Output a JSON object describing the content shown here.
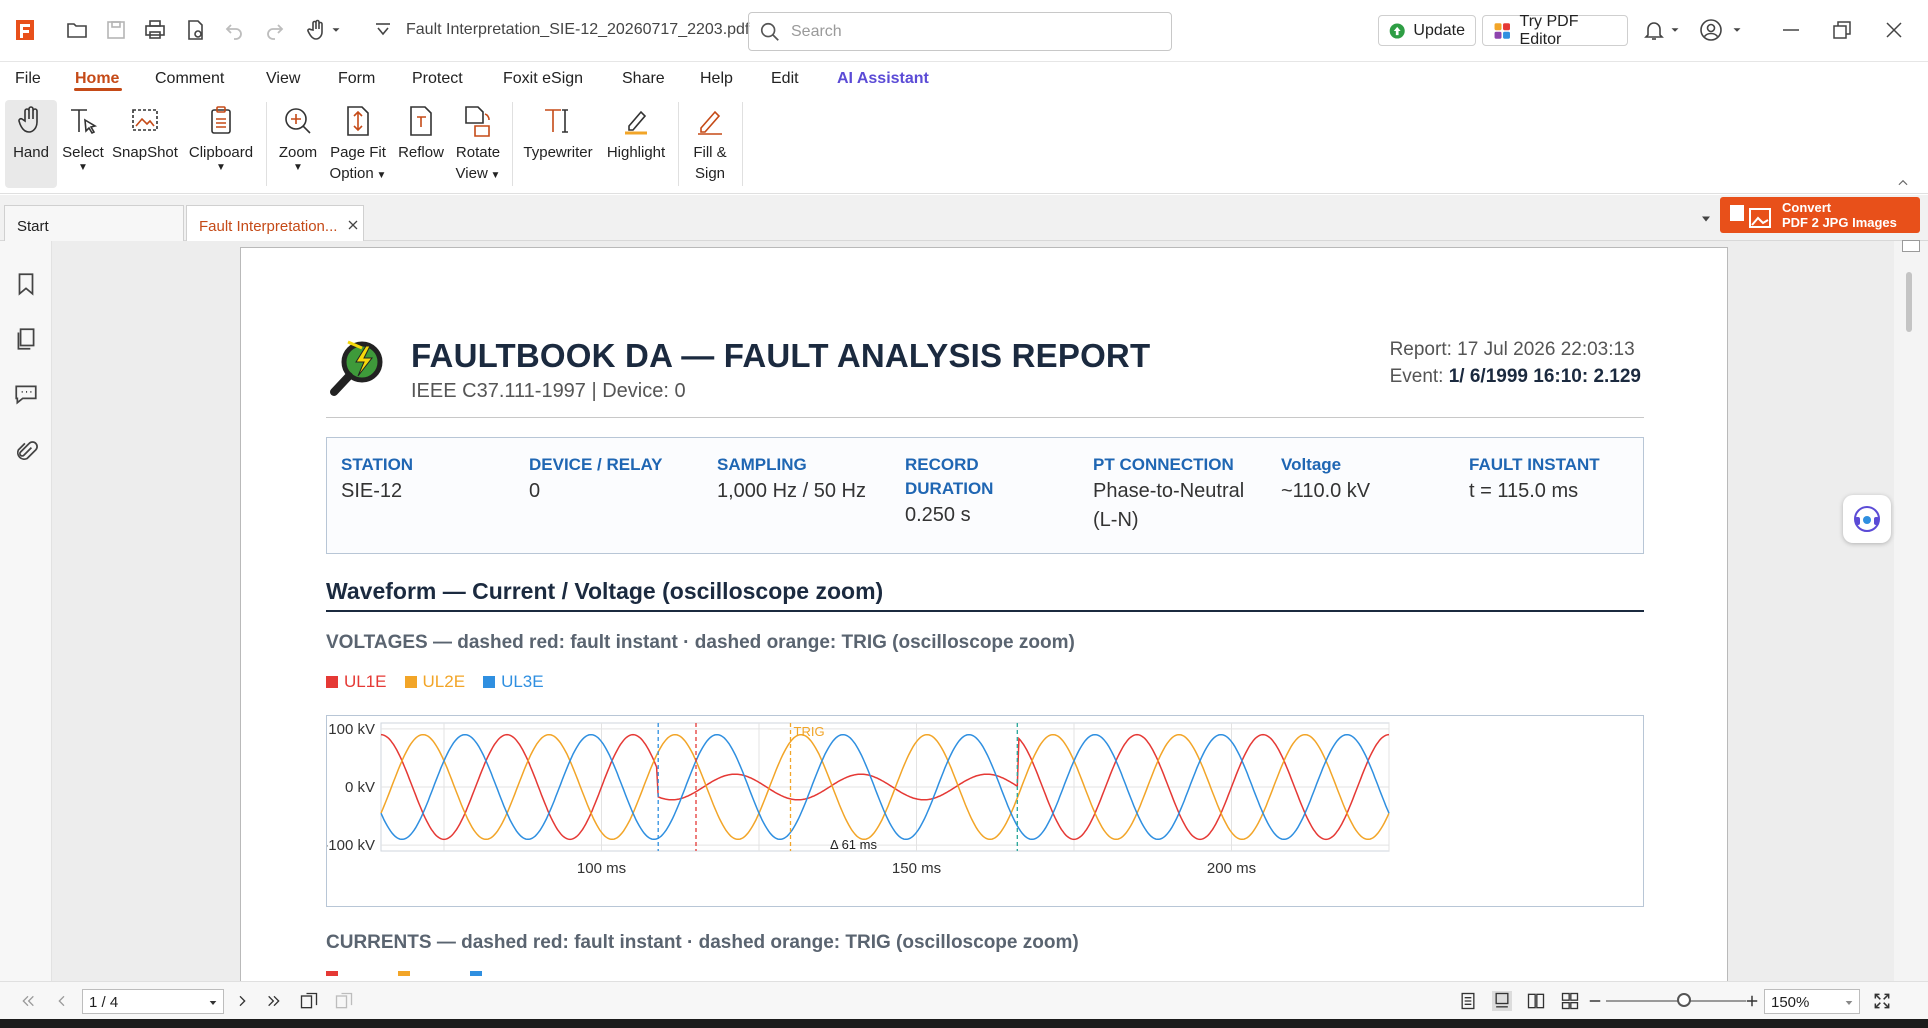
{
  "titlebar": {
    "filename": "Fault Interpretation_SIE-12_20260717_2203.pdf",
    "search_placeholder": "Search",
    "update_label": "Update",
    "try_editor_label": "Try PDF Editor"
  },
  "menu": [
    "File",
    "Home",
    "Comment",
    "View",
    "Form",
    "Protect",
    "Foxit eSign",
    "Share",
    "Help",
    "Edit",
    "AI Assistant"
  ],
  "ribbon": {
    "hand": "Hand",
    "select": "Select",
    "snapshot": "SnapShot",
    "clipboard": "Clipboard",
    "zoom": "Zoom",
    "pagefit_1": "Page Fit",
    "pagefit_2": "Option",
    "reflow": "Reflow",
    "rotate_1": "Rotate",
    "rotate_2": "View",
    "typewriter": "Typewriter",
    "highlight": "Highlight",
    "fill_1": "Fill &",
    "fill_2": "Sign"
  },
  "tabs": {
    "start": "Start",
    "doc": "Fault Interpretation..."
  },
  "convert": {
    "line1": "Convert",
    "line2": "PDF 2 JPG Images"
  },
  "report": {
    "title": "FAULTBOOK DA — FAULT ANALYSIS REPORT",
    "subtitle": "IEEE C37.111-1997  |  Device: 0",
    "report_label": "Report: 17 Jul 2026 22:03:13",
    "event_label": "Event: ",
    "event_value": "1/ 6/1999 16:10: 2.129",
    "info": [
      {
        "label": "STATION",
        "value": "SIE-12"
      },
      {
        "label": "DEVICE / RELAY",
        "value": "0"
      },
      {
        "label": "SAMPLING",
        "value": "1,000 Hz / 50 Hz"
      },
      {
        "label": "RECORD DURATION",
        "value": "0.250 s"
      },
      {
        "label": "PT CONNECTION",
        "value": "Phase-to-Neutral (L-N)"
      },
      {
        "label": "Voltage",
        "value": "~110.0 kV"
      },
      {
        "label": "FAULT INSTANT",
        "value": "t = 115.0 ms"
      }
    ],
    "section_title": "Waveform — Current / Voltage (oscilloscope zoom)",
    "caption_voltages": "VOLTAGES — dashed red: fault instant · dashed orange: TRIG (oscilloscope zoom)",
    "caption_currents": "CURRENTS — dashed red: fault instant · dashed orange: TRIG (oscilloscope zoom)"
  },
  "colors": {
    "ul1e": "#e53935",
    "ul2e": "#f2a528",
    "ul3e": "#2f8fe0",
    "accent": "#c54a17"
  },
  "chart_data": {
    "type": "line",
    "title": "",
    "xlabel": "",
    "ylabel": "",
    "x_ticks": [
      "100 ms",
      "150 ms",
      "200 ms"
    ],
    "y_ticks": [
      "100 kV",
      "0 kV",
      "-100 kV"
    ],
    "xlim": [
      65,
      225
    ],
    "ylim": [
      -110,
      110
    ],
    "grid": true,
    "legend": "top-left",
    "series": [
      {
        "name": "UL1E",
        "color": "#e53935"
      },
      {
        "name": "UL2E",
        "color": "#f2a528"
      },
      {
        "name": "UL3E",
        "color": "#2f8fe0"
      }
    ],
    "phase_amplitude_kv": 90,
    "frequency_hz": 50,
    "fault_window_ms": [
      109,
      166
    ],
    "ul1e_fault_amplitude_kv": 22,
    "markers": [
      {
        "x": 109,
        "color": "#2f8fe0",
        "label": ""
      },
      {
        "x": 115,
        "color": "#e53935",
        "label": ""
      },
      {
        "x": 130,
        "color": "#f2a528",
        "label": "TRIG"
      },
      {
        "x": 166,
        "color": "#26a69a",
        "label": ""
      }
    ],
    "annotation": "Δ 61 ms"
  },
  "statusbar": {
    "page": "1 / 4",
    "zoom": "150%"
  }
}
